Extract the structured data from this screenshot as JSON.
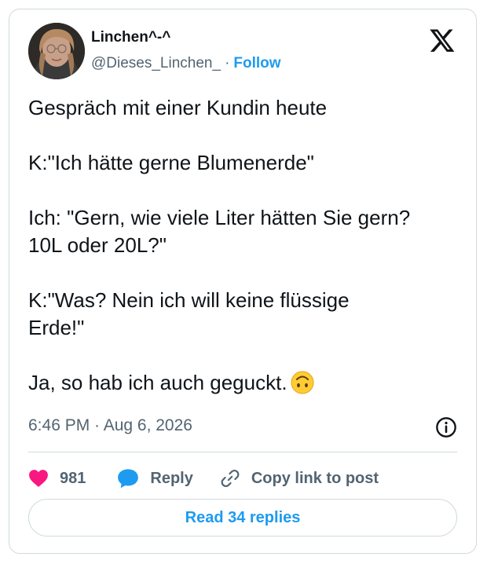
{
  "author": {
    "display_name": "Linchen^-^",
    "handle": "@Dieses_Linchen_",
    "separator": "·",
    "follow_label": "Follow"
  },
  "tweet": {
    "paragraphs": [
      [
        "Gespräch mit einer Kundin heute"
      ],
      [
        "K:\"Ich hätte gerne Blumenerde\""
      ],
      [
        "Ich: \"Gern, wie viele Liter hätten Sie gern?",
        "10L oder 20L?\""
      ],
      [
        "K:\"Was? Nein ich will keine flüssige",
        "Erde!\""
      ],
      [
        "Ja, so hab ich auch geguckt."
      ]
    ],
    "emoji": "upside-down-face-emoji"
  },
  "meta": {
    "timestamp": "6:46 PM · Aug 6, 2026"
  },
  "actions": {
    "like_count": "981",
    "reply_label": "Reply",
    "copy_label": "Copy link to post"
  },
  "read_replies_label": "Read 34 replies",
  "colors": {
    "accent": "#1d9bf0",
    "like": "#f91880",
    "text": "#0f1419",
    "muted": "#536471",
    "border": "#cfd9de"
  },
  "icons": [
    "x-logo-icon",
    "info-icon",
    "heart-icon",
    "reply-bubble-icon",
    "link-icon"
  ]
}
